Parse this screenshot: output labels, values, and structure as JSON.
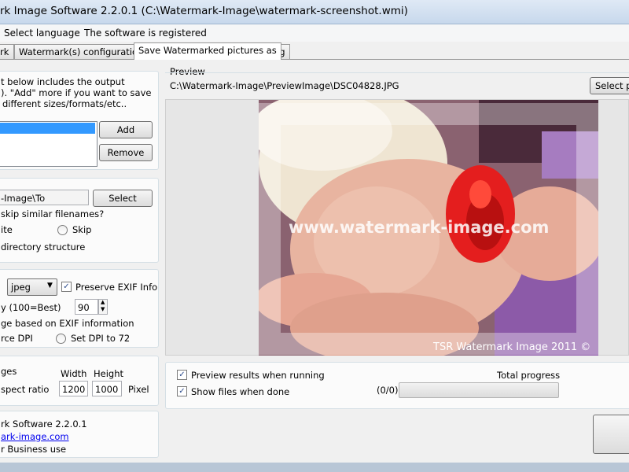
{
  "window": {
    "title": "rk Image Software 2.2.0.1 (C:\\Watermark-Image\\watermark-screenshot.wmi)"
  },
  "menu": {
    "items": [
      "Select language",
      "The software is registered"
    ]
  },
  "tabs": [
    {
      "label": "rk",
      "active": false
    },
    {
      "label": "Watermark(s) configuration",
      "active": false
    },
    {
      "label": "Save Watermarked pictures as",
      "active": true
    },
    {
      "label": "Log",
      "active": false
    }
  ],
  "outputs": {
    "description_lines": [
      "t below includes the output",
      "). \"Add\" more if you want to save",
      "different sizes/formats/etc.."
    ],
    "add_label": "Add",
    "remove_label": "Remove"
  },
  "destination": {
    "path": "-Image\\To",
    "select_label": "Select",
    "question": "skip similar filenames?",
    "overwrite_label": "ite",
    "skip_label": "Skip",
    "structure_label": "directory structure"
  },
  "format": {
    "selected": "jpeg",
    "preserve_exif_label": "Preserve EXIF Info",
    "preserve_exif_checked": true,
    "quality_label": "y (100=Best)",
    "quality_value": "90",
    "rotate_label": "ge based on EXIF information",
    "force_dpi_label": "rce DPI",
    "set_dpi_label": "Set DPI to 72"
  },
  "resize": {
    "title": "ges",
    "width_label": "Width",
    "height_label": "Height",
    "aspect_label": "spect ratio",
    "width_value": "1200",
    "height_value": "1000",
    "unit": "Pixel"
  },
  "about": {
    "line1": "rk Software 2.2.0.1",
    "link": "ark-image.com",
    "line3": "r Business use"
  },
  "preview": {
    "label": "Preview",
    "path": "C:\\Watermark-Image\\PreviewImage\\DSC04828.JPG",
    "select_label": "Select pr",
    "watermark_text": "www.watermark-image.com",
    "copyright_text": "TSR Watermark Image 2011 ©"
  },
  "progress": {
    "preview_results_label": "Preview results when running",
    "preview_results_checked": true,
    "show_files_label": "Show files when done",
    "show_files_checked": true,
    "total_label": "Total progress",
    "count": "(0/0)",
    "fraction": 0
  },
  "colors": {
    "accent": "#2b4a8c",
    "link": "#0000ee"
  }
}
